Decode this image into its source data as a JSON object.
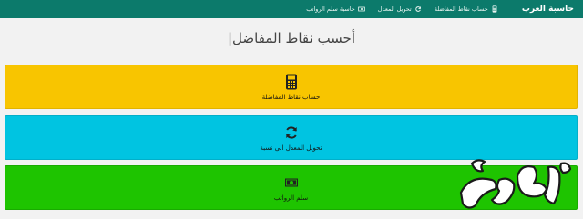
{
  "navbar": {
    "brand": "حاسبة العرب",
    "links": [
      {
        "label": "حساب نقاط المفاضلة",
        "icon": "calculator-icon"
      },
      {
        "label": "تحويل المعدل",
        "icon": "refresh-icon"
      },
      {
        "label": "حاسبة سلم الرواتب",
        "icon": "money-icon"
      }
    ]
  },
  "page": {
    "title": "أحسب نقاط المفاضل|"
  },
  "cards": [
    {
      "label": "حساب نقاط المفاضلة",
      "icon": "calculator-icon",
      "color": "#f8c500"
    },
    {
      "label": "تحويل المعدل الى نسبة",
      "icon": "refresh-icon",
      "color": "#00c4e1"
    },
    {
      "label": "سلم الرواتب",
      "icon": "money-icon",
      "color": "#1ec400"
    }
  ],
  "watermark": {
    "text": "رؤيا",
    "icon": "ruya-logo-watermark"
  }
}
